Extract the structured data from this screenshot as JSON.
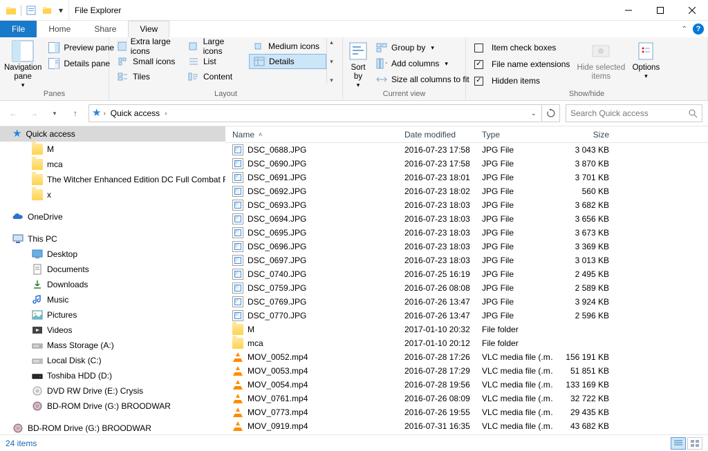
{
  "title": "File Explorer",
  "tabs": {
    "file": "File",
    "home": "Home",
    "share": "Share",
    "view": "View"
  },
  "ribbon": {
    "panes": {
      "nav": "Navigation\npane",
      "preview": "Preview pane",
      "details": "Details pane",
      "label": "Panes"
    },
    "layout": {
      "items": [
        "Extra large icons",
        "Large icons",
        "Medium icons",
        "Small icons",
        "List",
        "Details",
        "Tiles",
        "Content"
      ],
      "label": "Layout"
    },
    "current": {
      "sort": "Sort\nby",
      "group": "Group by",
      "add_cols": "Add columns",
      "size_all": "Size all columns to fit",
      "label": "Current view"
    },
    "show": {
      "check": "Item check boxes",
      "ext": "File name extensions",
      "hidden": "Hidden items",
      "hide_sel": "Hide selected\nitems",
      "options": "Options",
      "label": "Show/hide"
    }
  },
  "breadcrumb": {
    "root": "Quick access"
  },
  "search_placeholder": "Search Quick access",
  "columns": {
    "name": "Name",
    "date": "Date modified",
    "type": "Type",
    "size": "Size"
  },
  "tree": [
    {
      "label": "Quick access",
      "icon": "star",
      "selected": true
    },
    {
      "label": "M",
      "icon": "folder",
      "indent": true
    },
    {
      "label": "mca",
      "icon": "folder",
      "indent": true
    },
    {
      "label": "The Witcher Enhanced Edition DC Full Combat Reba",
      "icon": "folder",
      "indent": true
    },
    {
      "label": "x",
      "icon": "folder",
      "indent": true
    },
    {
      "label": "",
      "icon": "",
      "spacer": true
    },
    {
      "label": "OneDrive",
      "icon": "onedrive"
    },
    {
      "label": "",
      "icon": "",
      "spacer": true
    },
    {
      "label": "This PC",
      "icon": "pc"
    },
    {
      "label": "Desktop",
      "icon": "desktop",
      "indent": true
    },
    {
      "label": "Documents",
      "icon": "docs",
      "indent": true
    },
    {
      "label": "Downloads",
      "icon": "downloads",
      "indent": true
    },
    {
      "label": "Music",
      "icon": "music",
      "indent": true
    },
    {
      "label": "Pictures",
      "icon": "pictures",
      "indent": true
    },
    {
      "label": "Videos",
      "icon": "videos",
      "indent": true
    },
    {
      "label": "Mass Storage (A:)",
      "icon": "drive",
      "indent": true
    },
    {
      "label": "Local Disk (C:)",
      "icon": "disk",
      "indent": true
    },
    {
      "label": "Toshiba HDD (D:)",
      "icon": "disk-ext",
      "indent": true
    },
    {
      "label": "DVD RW Drive (E:) Crysis",
      "icon": "disc",
      "indent": true
    },
    {
      "label": "BD-ROM Drive (G:) BROODWAR",
      "icon": "bd",
      "indent": true
    },
    {
      "label": "",
      "icon": "",
      "spacer": true
    },
    {
      "label": "BD-ROM Drive (G:) BROODWAR",
      "icon": "bd"
    }
  ],
  "files": [
    {
      "name": "DSC_0688.JPG",
      "date": "2016-07-23 17:58",
      "type": "JPG File",
      "size": "3 043 KB",
      "icon": "jpg"
    },
    {
      "name": "DSC_0690.JPG",
      "date": "2016-07-23 17:58",
      "type": "JPG File",
      "size": "3 870 KB",
      "icon": "jpg"
    },
    {
      "name": "DSC_0691.JPG",
      "date": "2016-07-23 18:01",
      "type": "JPG File",
      "size": "3 701 KB",
      "icon": "jpg"
    },
    {
      "name": "DSC_0692.JPG",
      "date": "2016-07-23 18:02",
      "type": "JPG File",
      "size": "560 KB",
      "icon": "jpg"
    },
    {
      "name": "DSC_0693.JPG",
      "date": "2016-07-23 18:03",
      "type": "JPG File",
      "size": "3 682 KB",
      "icon": "jpg"
    },
    {
      "name": "DSC_0694.JPG",
      "date": "2016-07-23 18:03",
      "type": "JPG File",
      "size": "3 656 KB",
      "icon": "jpg"
    },
    {
      "name": "DSC_0695.JPG",
      "date": "2016-07-23 18:03",
      "type": "JPG File",
      "size": "3 673 KB",
      "icon": "jpg"
    },
    {
      "name": "DSC_0696.JPG",
      "date": "2016-07-23 18:03",
      "type": "JPG File",
      "size": "3 369 KB",
      "icon": "jpg"
    },
    {
      "name": "DSC_0697.JPG",
      "date": "2016-07-23 18:03",
      "type": "JPG File",
      "size": "3 013 KB",
      "icon": "jpg"
    },
    {
      "name": "DSC_0740.JPG",
      "date": "2016-07-25 16:19",
      "type": "JPG File",
      "size": "2 495 KB",
      "icon": "jpg"
    },
    {
      "name": "DSC_0759.JPG",
      "date": "2016-07-26 08:08",
      "type": "JPG File",
      "size": "2 589 KB",
      "icon": "jpg"
    },
    {
      "name": "DSC_0769.JPG",
      "date": "2016-07-26 13:47",
      "type": "JPG File",
      "size": "3 924 KB",
      "icon": "jpg"
    },
    {
      "name": "DSC_0770.JPG",
      "date": "2016-07-26 13:47",
      "type": "JPG File",
      "size": "2 596 KB",
      "icon": "jpg"
    },
    {
      "name": "M",
      "date": "2017-01-10 20:32",
      "type": "File folder",
      "size": "",
      "icon": "folder"
    },
    {
      "name": "mca",
      "date": "2017-01-10 20:12",
      "type": "File folder",
      "size": "",
      "icon": "folder"
    },
    {
      "name": "MOV_0052.mp4",
      "date": "2016-07-28 17:26",
      "type": "VLC media file (.m…",
      "size": "156 191 KB",
      "icon": "vlc"
    },
    {
      "name": "MOV_0053.mp4",
      "date": "2016-07-28 17:29",
      "type": "VLC media file (.m…",
      "size": "51 851 KB",
      "icon": "vlc"
    },
    {
      "name": "MOV_0054.mp4",
      "date": "2016-07-28 19:56",
      "type": "VLC media file (.m…",
      "size": "133 169 KB",
      "icon": "vlc"
    },
    {
      "name": "MOV_0761.mp4",
      "date": "2016-07-26 08:09",
      "type": "VLC media file (.m…",
      "size": "32 722 KB",
      "icon": "vlc"
    },
    {
      "name": "MOV_0773.mp4",
      "date": "2016-07-26 19:55",
      "type": "VLC media file (.m…",
      "size": "29 435 KB",
      "icon": "vlc"
    },
    {
      "name": "MOV_0919.mp4",
      "date": "2016-07-31 16:35",
      "type": "VLC media file (.m…",
      "size": "43 682 KB",
      "icon": "vlc"
    }
  ],
  "status": "24 items"
}
